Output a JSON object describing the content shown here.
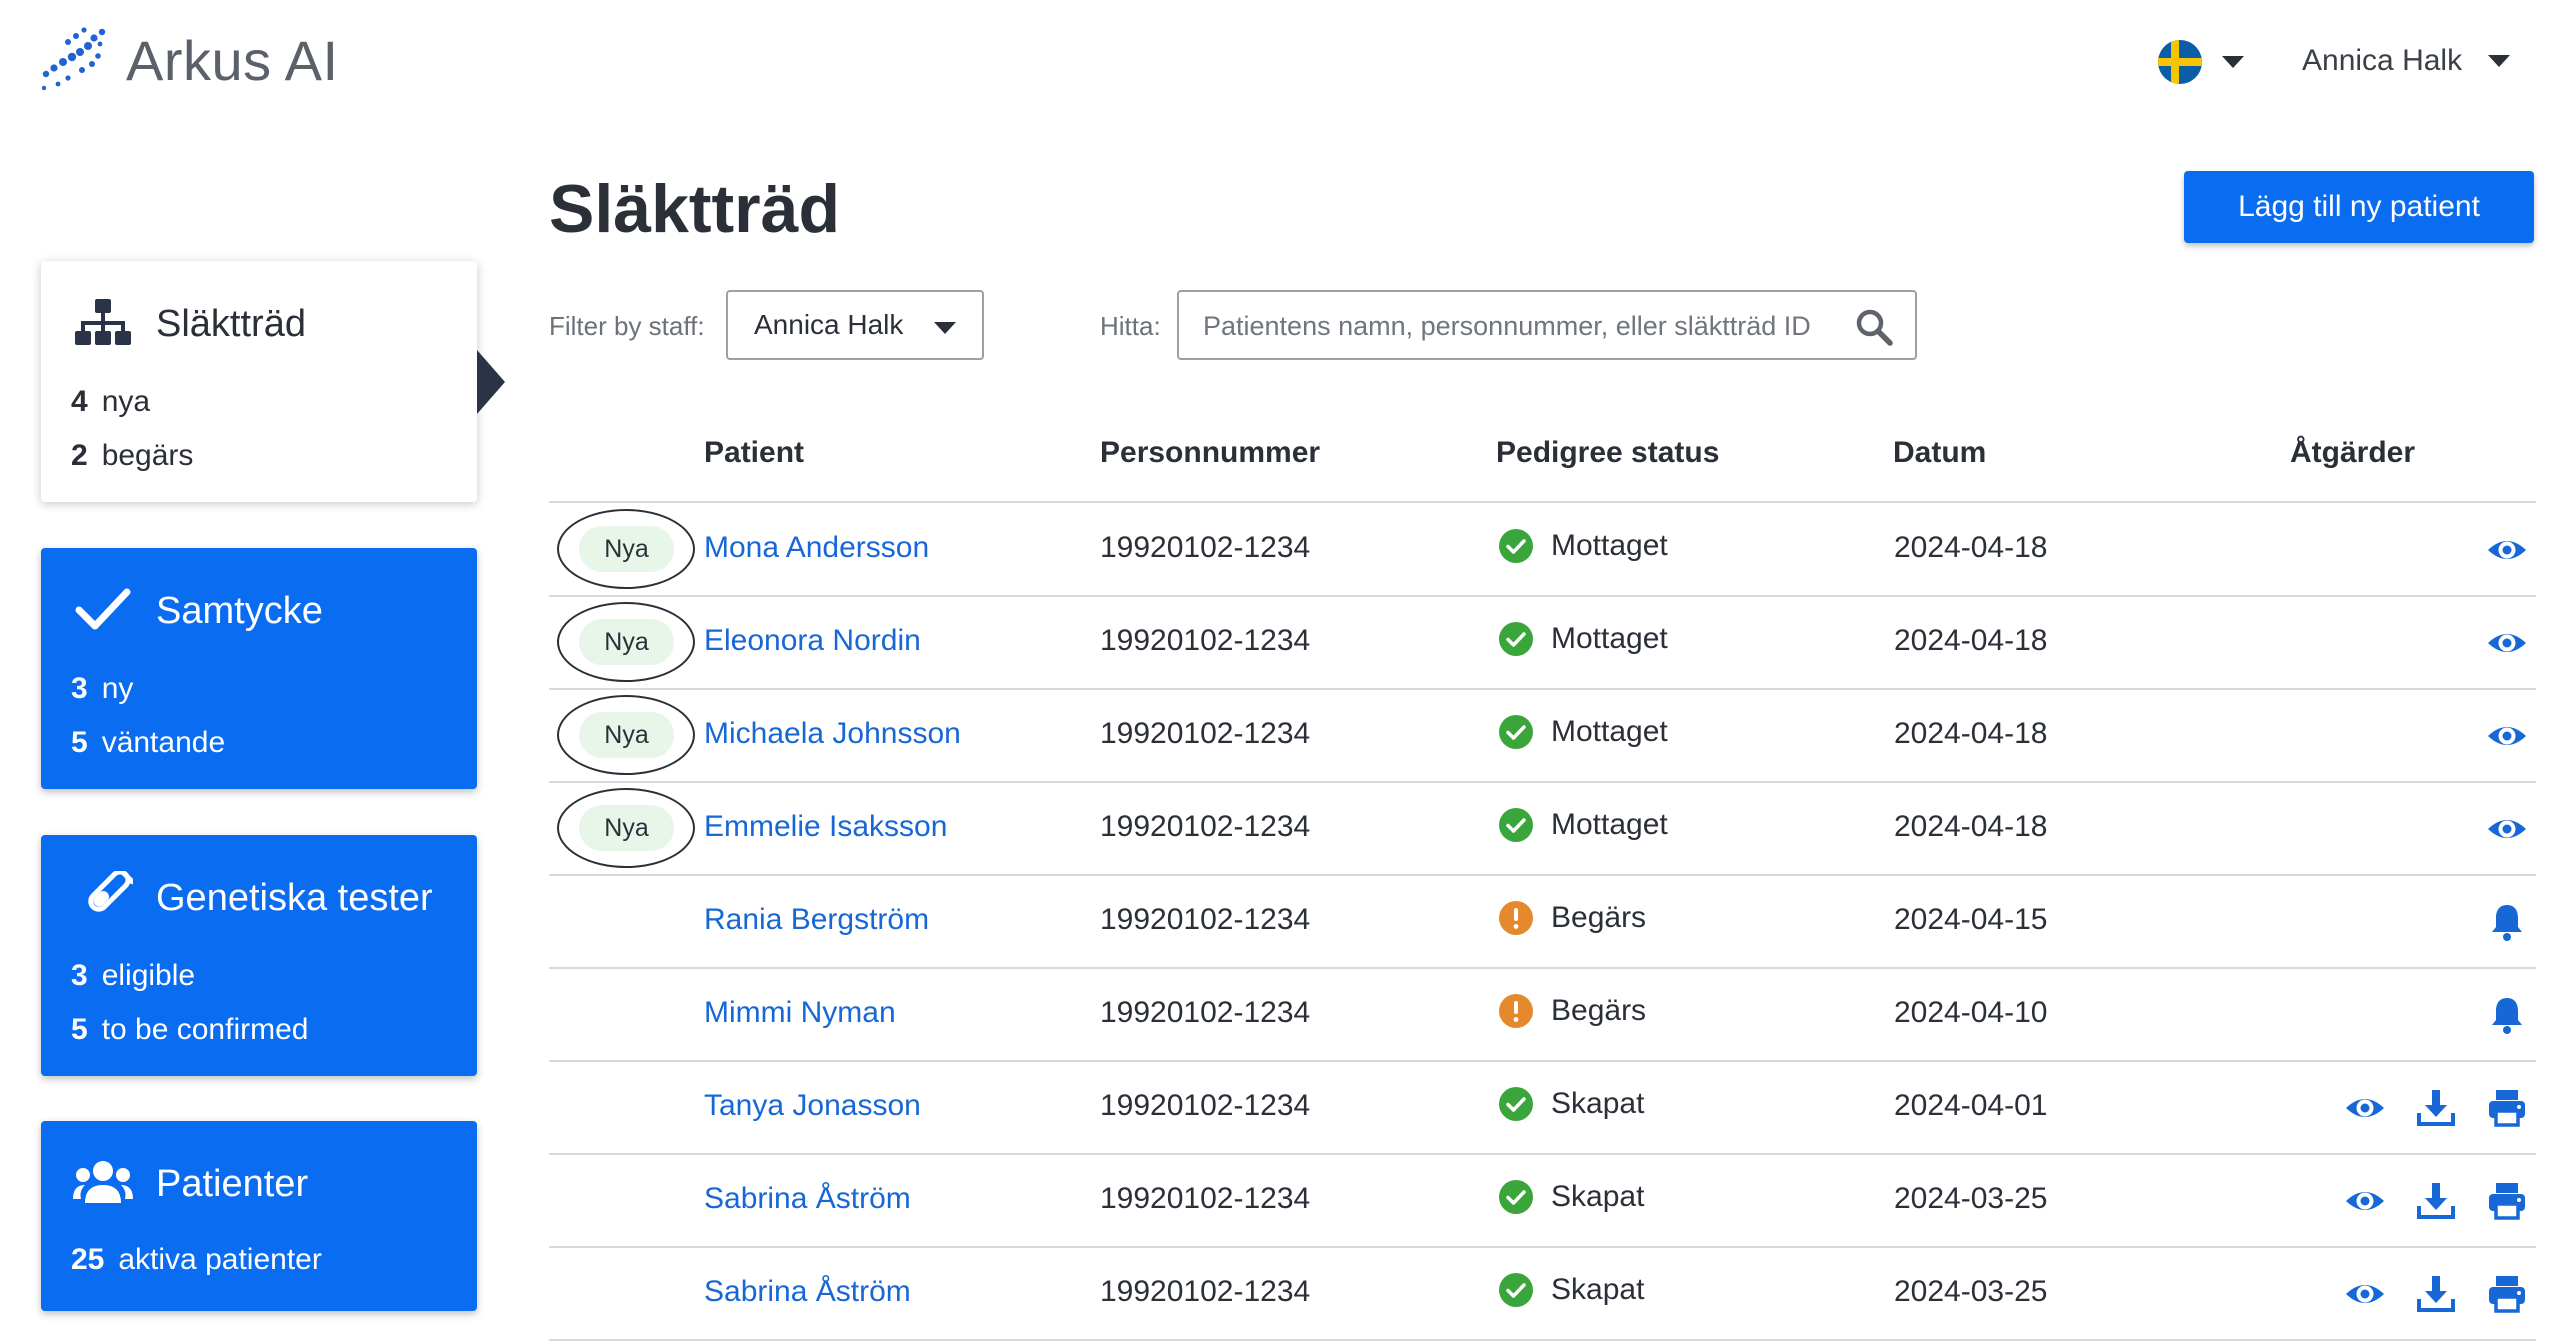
{
  "app": {
    "name": "Arkus AI"
  },
  "header": {
    "user": "Annica Halk",
    "language_icon": "swedish-flag-icon"
  },
  "colors": {
    "primary": "#0a6cf0",
    "link": "#1767d6",
    "success": "#3aa53a",
    "warning": "#e58a2c",
    "new_badge_bg": "#e8f6e9"
  },
  "sidebar": {
    "cards": [
      {
        "title": "Släktträd",
        "icon": "family-tree-icon",
        "stats": [
          {
            "count": "4",
            "label": "nya"
          },
          {
            "count": "2",
            "label": "begärs"
          }
        ]
      },
      {
        "title": "Samtycke",
        "icon": "checkmark-icon",
        "stats": [
          {
            "count": "3",
            "label": "ny"
          },
          {
            "count": "5",
            "label": "väntande"
          }
        ]
      },
      {
        "title": "Genetiska tester",
        "icon": "test-tube-icon",
        "stats": [
          {
            "count": "3",
            "label": "eligible"
          },
          {
            "count": "5",
            "label": "to be confirmed"
          }
        ]
      },
      {
        "title": "Patienter",
        "icon": "users-icon",
        "stats": [
          {
            "count": "25",
            "label": "aktiva patienter"
          }
        ]
      }
    ]
  },
  "main": {
    "title": "Släktträd",
    "add_button": "Lägg till ny patient",
    "filter": {
      "label": "Filter by staff:",
      "value": "Annica Halk"
    },
    "search": {
      "label": "Hitta:",
      "placeholder": "Patientens namn, personnummer, eller släktträd ID"
    }
  },
  "table": {
    "headers": [
      "Patient",
      "Personnummer",
      "Pedigree status",
      "Datum",
      "Åtgärder"
    ],
    "rows": [
      {
        "new": "Nya",
        "patient": "Mona Andersson",
        "personnummer": "19920102-1234",
        "status": "Mottaget",
        "status_type": "success",
        "date": "2024-04-18",
        "actions": [
          "view"
        ]
      },
      {
        "new": "Nya",
        "patient": "Eleonora Nordin",
        "personnummer": "19920102-1234",
        "status": "Mottaget",
        "status_type": "success",
        "date": "2024-04-18",
        "actions": [
          "view"
        ]
      },
      {
        "new": "Nya",
        "patient": "Michaela Johnsson",
        "personnummer": "19920102-1234",
        "status": "Mottaget",
        "status_type": "success",
        "date": "2024-04-18",
        "actions": [
          "view"
        ]
      },
      {
        "new": "Nya",
        "patient": "Emmelie Isaksson",
        "personnummer": "19920102-1234",
        "status": "Mottaget",
        "status_type": "success",
        "date": "2024-04-18",
        "actions": [
          "view"
        ]
      },
      {
        "new": "",
        "patient": "Rania Bergström",
        "personnummer": "19920102-1234",
        "status": "Begärs",
        "status_type": "warning",
        "date": "2024-04-15",
        "actions": [
          "remind"
        ]
      },
      {
        "new": "",
        "patient": "Mimmi Nyman",
        "personnummer": "19920102-1234",
        "status": "Begärs",
        "status_type": "warning",
        "date": "2024-04-10",
        "actions": [
          "remind"
        ]
      },
      {
        "new": "",
        "patient": "Tanya Jonasson",
        "personnummer": "19920102-1234",
        "status": "Skapat",
        "status_type": "success",
        "date": "2024-04-01",
        "actions": [
          "view",
          "download",
          "print"
        ]
      },
      {
        "new": "",
        "patient": "Sabrina Åström",
        "personnummer": "19920102-1234",
        "status": "Skapat",
        "status_type": "success",
        "date": "2024-03-25",
        "actions": [
          "view",
          "download",
          "print"
        ]
      },
      {
        "new": "",
        "patient": "Sabrina Åström",
        "personnummer": "19920102-1234",
        "status": "Skapat",
        "status_type": "success",
        "date": "2024-03-25",
        "actions": [
          "view",
          "download",
          "print"
        ]
      }
    ]
  }
}
